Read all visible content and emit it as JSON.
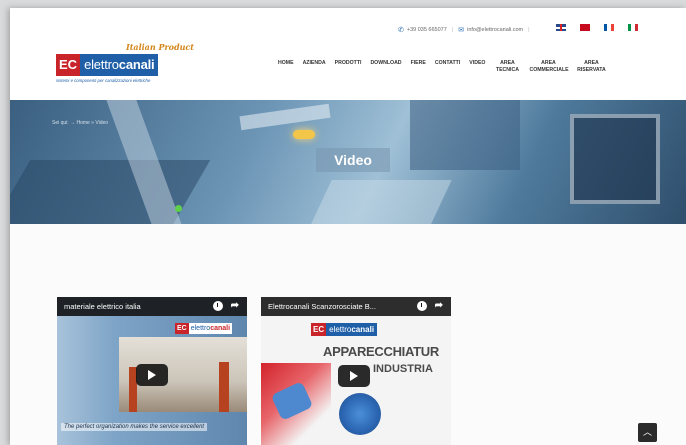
{
  "header": {
    "phone": "+39 035 665077",
    "email": "info@elettrocanali.com",
    "logo": {
      "tagline": "Italian Product",
      "brand_prefix": "EC",
      "brand_light": "elettro",
      "brand_bold": "canali",
      "subtitle": "sistemi e componenti per canalizzazioni elettriche"
    },
    "languages": [
      "EN",
      "ES",
      "FR",
      "IT"
    ],
    "nav": [
      {
        "label": "HOME"
      },
      {
        "label": "AZIENDA"
      },
      {
        "label": "PRODOTTI"
      },
      {
        "label": "DOWNLOAD"
      },
      {
        "label": "FIERE"
      },
      {
        "label": "CONTATTI"
      },
      {
        "label": "VIDEO"
      },
      {
        "label": "AREA TECNICA"
      },
      {
        "label": "AREA COMMERCIALE"
      },
      {
        "label": "AREA RISERVATA"
      }
    ]
  },
  "hero": {
    "breadcrumb": "Sei qui: → Home » Video",
    "title": "Video"
  },
  "videos": [
    {
      "title": "materiale elettrico italia",
      "caption": "The perfect organization makes the service excellent"
    },
    {
      "title": "Elettrocanali Scanzorosciate B...",
      "headline": "APPARECCHIATUR",
      "headline2": "INDUSTRIA"
    }
  ],
  "colors": {
    "brand_red": "#c8242a",
    "brand_blue": "#1f5fa8",
    "tagline_orange": "#d3861a"
  }
}
